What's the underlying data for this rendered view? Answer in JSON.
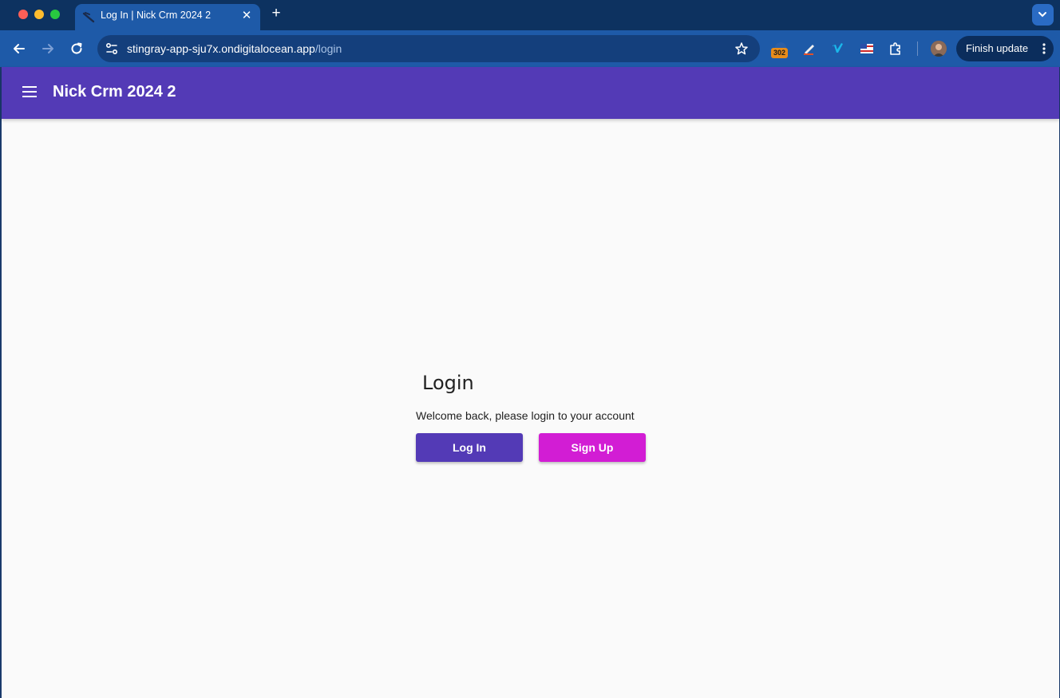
{
  "browser": {
    "tab_title": "Log In | Nick Crm 2024 2",
    "url_host": "stingray-app-sju7x.ondigitalocean.app",
    "url_path": "/login",
    "extension_badge": "302",
    "finish_update_label": "Finish update"
  },
  "app": {
    "title": "Nick Crm 2024 2"
  },
  "login": {
    "heading": "Login",
    "subtitle": "Welcome back, please login to your account",
    "login_button": "Log In",
    "signup_button": "Sign Up"
  },
  "colors": {
    "appbar": "#533ab6",
    "primary_button": "#533ab6",
    "secondary_button": "#d21dd4",
    "tab_active": "#1e5aa8",
    "tab_strip": "#0d3260"
  },
  "icons": {
    "back": "arrow-left-icon",
    "forward": "arrow-right-icon",
    "reload": "reload-icon",
    "site_info": "tune-icon",
    "bookmark": "star-icon",
    "menu": "hamburger-icon"
  }
}
